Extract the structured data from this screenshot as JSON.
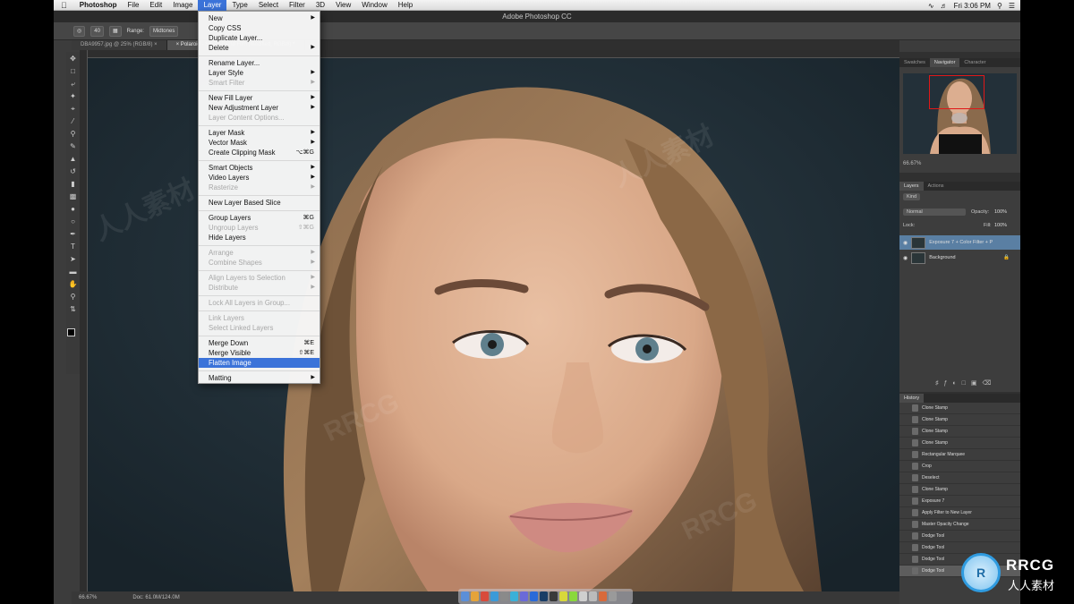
{
  "menubar": {
    "apple": "",
    "app_name": "Photoshop",
    "items": [
      "File",
      "Edit",
      "Image",
      "Layer",
      "Type",
      "Select",
      "Filter",
      "3D",
      "View",
      "Window",
      "Help"
    ],
    "active": "Layer",
    "clock": "Fri 3:06 PM"
  },
  "window_title": "Adobe Photoshop CC",
  "options_bar": {
    "range_label": "Range:",
    "range_value": "Midtones",
    "tool_size": "40"
  },
  "doc_tabs": [
    {
      "label": "DBA9957.jpg @ 25% (RGB/8) ×",
      "active": false
    },
    {
      "label": "× Polaroid - SX-70 Blend Film (modified, RGB/8) *",
      "active": true
    }
  ],
  "layer_menu": [
    {
      "label": "New",
      "arrow": true
    },
    {
      "label": "Copy CSS"
    },
    {
      "label": "Duplicate Layer..."
    },
    {
      "label": "Delete",
      "arrow": true
    },
    {
      "sep": true
    },
    {
      "label": "Rename Layer..."
    },
    {
      "label": "Layer Style",
      "arrow": true
    },
    {
      "label": "Smart Filter",
      "disabled": true,
      "arrow": true
    },
    {
      "sep": true
    },
    {
      "label": "New Fill Layer",
      "arrow": true
    },
    {
      "label": "New Adjustment Layer",
      "arrow": true
    },
    {
      "label": "Layer Content Options...",
      "disabled": true
    },
    {
      "sep": true
    },
    {
      "label": "Layer Mask",
      "arrow": true
    },
    {
      "label": "Vector Mask",
      "arrow": true
    },
    {
      "label": "Create Clipping Mask",
      "shortcut": "⌥⌘G"
    },
    {
      "sep": true
    },
    {
      "label": "Smart Objects",
      "arrow": true
    },
    {
      "label": "Video Layers",
      "arrow": true
    },
    {
      "label": "Rasterize",
      "disabled": true,
      "arrow": true
    },
    {
      "sep": true
    },
    {
      "label": "New Layer Based Slice"
    },
    {
      "sep": true
    },
    {
      "label": "Group Layers",
      "shortcut": "⌘G"
    },
    {
      "label": "Ungroup Layers",
      "disabled": true,
      "shortcut": "⇧⌘G"
    },
    {
      "label": "Hide Layers"
    },
    {
      "sep": true
    },
    {
      "label": "Arrange",
      "disabled": true,
      "arrow": true
    },
    {
      "label": "Combine Shapes",
      "disabled": true,
      "arrow": true
    },
    {
      "sep": true
    },
    {
      "label": "Align Layers to Selection",
      "disabled": true,
      "arrow": true
    },
    {
      "label": "Distribute",
      "disabled": true,
      "arrow": true
    },
    {
      "sep": true
    },
    {
      "label": "Lock All Layers in Group...",
      "disabled": true
    },
    {
      "sep": true
    },
    {
      "label": "Link Layers",
      "disabled": true
    },
    {
      "label": "Select Linked Layers",
      "disabled": true
    },
    {
      "sep": true
    },
    {
      "label": "Merge Down",
      "shortcut": "⌘E"
    },
    {
      "label": "Merge Visible",
      "shortcut": "⇧⌘E"
    },
    {
      "label": "Flatten Image",
      "highlighted": true
    },
    {
      "sep": true
    },
    {
      "label": "Matting",
      "arrow": true
    }
  ],
  "panels": {
    "navigator_tabs": [
      "Swatches",
      "Navigator",
      "Character"
    ],
    "navigator_active": "Navigator",
    "zoom": "66.67%",
    "layers_tabs": [
      "Layers",
      "Actions"
    ],
    "layers_active": "Layers",
    "blend_mode": "Normal",
    "opacity_label": "Opacity:",
    "opacity": "100%",
    "lock_label": "Lock:",
    "fill_label": "Fill:",
    "fill": "100%",
    "kind": "Kind",
    "layers": [
      {
        "name": "Exposure 7 + Color Filter + P",
        "selected": true
      },
      {
        "name": "Background",
        "selected": false
      }
    ],
    "history_title": "History",
    "history": [
      "Clone Stamp",
      "Clone Stamp",
      "Clone Stamp",
      "Clone Stamp",
      "Rectangular Marquee",
      "Crop",
      "Deselect",
      "Clone Stamp",
      "Exposure 7",
      "Apply Filter to New Layer",
      "Master Opacity Change",
      "Dodge Tool",
      "Dodge Tool",
      "Dodge Tool",
      "Dodge Tool"
    ]
  },
  "status_bar": {
    "zoom": "66.67%",
    "doc": "Doc: 61.0M/124.0M"
  },
  "watermark": {
    "brand": "RRCG",
    "chinese": "人人素材"
  },
  "colors": {
    "menu_highlight": "#3b73d9",
    "layer_selected": "#5a7fa3",
    "nav_box": "#e01818",
    "canvas_bg": "#213039"
  }
}
